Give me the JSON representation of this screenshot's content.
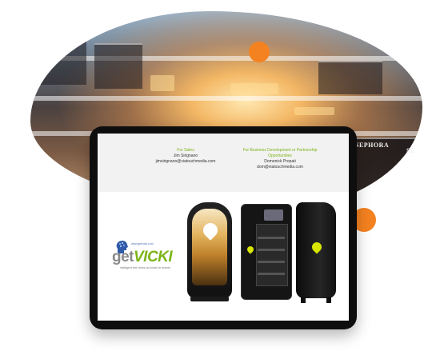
{
  "brand": {
    "accent": "#7cb518",
    "orange": "#f58220",
    "kiosk_accent": "#d8e600"
  },
  "background": {
    "store_sign": "SEPHORA",
    "store_sign_partial": "SE"
  },
  "contacts": {
    "sales": {
      "role": "For Sales",
      "name": "Jim Sirignano",
      "email": "jimsirignano@viatouchmedia.com"
    },
    "business": {
      "role": "For Business Development or Partnership Opportunities",
      "name": "Domenick Propati",
      "email": "dom@viatouchmedia.com"
    }
  },
  "logo": {
    "url": "www.getvicki.com",
    "word_get": "get",
    "word_vicki": "VICKI",
    "tagline": "intelligent self check-out kiosk for brands"
  },
  "icons": {
    "logo_head": "brain-head-icon",
    "kiosk_pin": "location-pin-icon"
  }
}
